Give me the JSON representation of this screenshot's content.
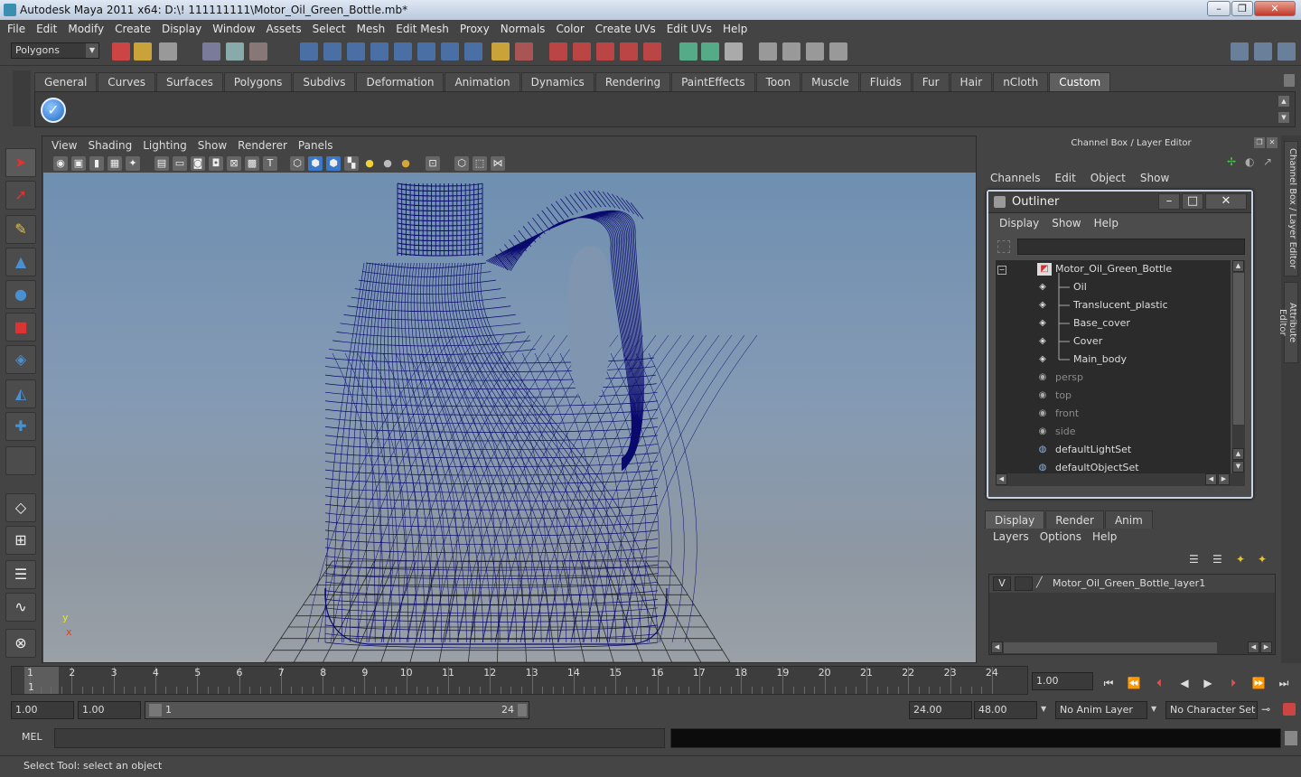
{
  "window": {
    "title": "Autodesk Maya 2011 x64: D:\\! 111111111\\Motor_Oil_Green_Bottle.mb*",
    "minimize": "–",
    "maximize": "❐",
    "close": "✕"
  },
  "menus": [
    "File",
    "Edit",
    "Modify",
    "Create",
    "Display",
    "Window",
    "Assets",
    "Select",
    "Mesh",
    "Edit Mesh",
    "Proxy",
    "Normals",
    "Color",
    "Create UVs",
    "Edit UVs",
    "Help"
  ],
  "toolbar": {
    "mode": "Polygons"
  },
  "shelf": {
    "tabs": [
      "General",
      "Curves",
      "Surfaces",
      "Polygons",
      "Subdivs",
      "Deformation",
      "Animation",
      "Dynamics",
      "Rendering",
      "PaintEffects",
      "Toon",
      "Muscle",
      "Fluids",
      "Fur",
      "Hair",
      "nCloth",
      "Custom"
    ],
    "active": "Custom"
  },
  "viewport": {
    "menus": [
      "View",
      "Shading",
      "Lighting",
      "Show",
      "Renderer",
      "Panels"
    ],
    "axis_y": "y",
    "axis_x": "x",
    "wire_color": "#0a0a6e"
  },
  "channel_box": {
    "title": "Channel Box / Layer Editor",
    "menus": [
      "Channels",
      "Edit",
      "Object",
      "Show"
    ]
  },
  "outliner": {
    "title": "Outliner",
    "menus": [
      "Display",
      "Show",
      "Help"
    ],
    "items": [
      {
        "label": "Motor_Oil_Green_Bottle",
        "icon": "group-icon",
        "level": 0,
        "dim": false
      },
      {
        "label": "Oil",
        "icon": "mesh-icon",
        "level": 1,
        "dim": false
      },
      {
        "label": "Translucent_plastic",
        "icon": "mesh-icon",
        "level": 1,
        "dim": false
      },
      {
        "label": "Base_cover",
        "icon": "mesh-icon",
        "level": 1,
        "dim": false
      },
      {
        "label": "Cover",
        "icon": "mesh-icon",
        "level": 1,
        "dim": false
      },
      {
        "label": "Main_body",
        "icon": "mesh-icon",
        "level": 1,
        "dim": false
      },
      {
        "label": "persp",
        "icon": "camera-icon",
        "level": 0,
        "dim": true
      },
      {
        "label": "top",
        "icon": "camera-icon",
        "level": 0,
        "dim": true
      },
      {
        "label": "front",
        "icon": "camera-icon",
        "level": 0,
        "dim": true
      },
      {
        "label": "side",
        "icon": "camera-icon",
        "level": 0,
        "dim": true
      },
      {
        "label": "defaultLightSet",
        "icon": "set-icon",
        "level": 0,
        "dim": false
      },
      {
        "label": "defaultObjectSet",
        "icon": "set-icon",
        "level": 0,
        "dim": false
      }
    ]
  },
  "side_tabs": [
    "Channel Box / Layer Editor",
    "Attribute Editor"
  ],
  "layers": {
    "tabs": [
      "Display",
      "Render",
      "Anim"
    ],
    "active": "Display",
    "menus": [
      "Layers",
      "Options",
      "Help"
    ],
    "rows": [
      {
        "visible": "V",
        "name": "Motor_Oil_Green_Bottle_layer1"
      }
    ]
  },
  "timeline": {
    "ticks": [
      "1",
      "2",
      "3",
      "4",
      "5",
      "6",
      "7",
      "8",
      "9",
      "10",
      "11",
      "12",
      "13",
      "14",
      "15",
      "16",
      "17",
      "18",
      "19",
      "20",
      "21",
      "22",
      "23",
      "24"
    ],
    "current": "1",
    "current_field": "1.00"
  },
  "range": {
    "start": "1.00",
    "anim_start": "1.00",
    "range_start": "1",
    "range_end": "24",
    "end": "24.00",
    "anim_end": "48.00",
    "anim_layer": "No Anim Layer",
    "character": "No Character Set"
  },
  "mel": {
    "label": "MEL"
  },
  "status": {
    "text": "Select Tool: select an object"
  }
}
